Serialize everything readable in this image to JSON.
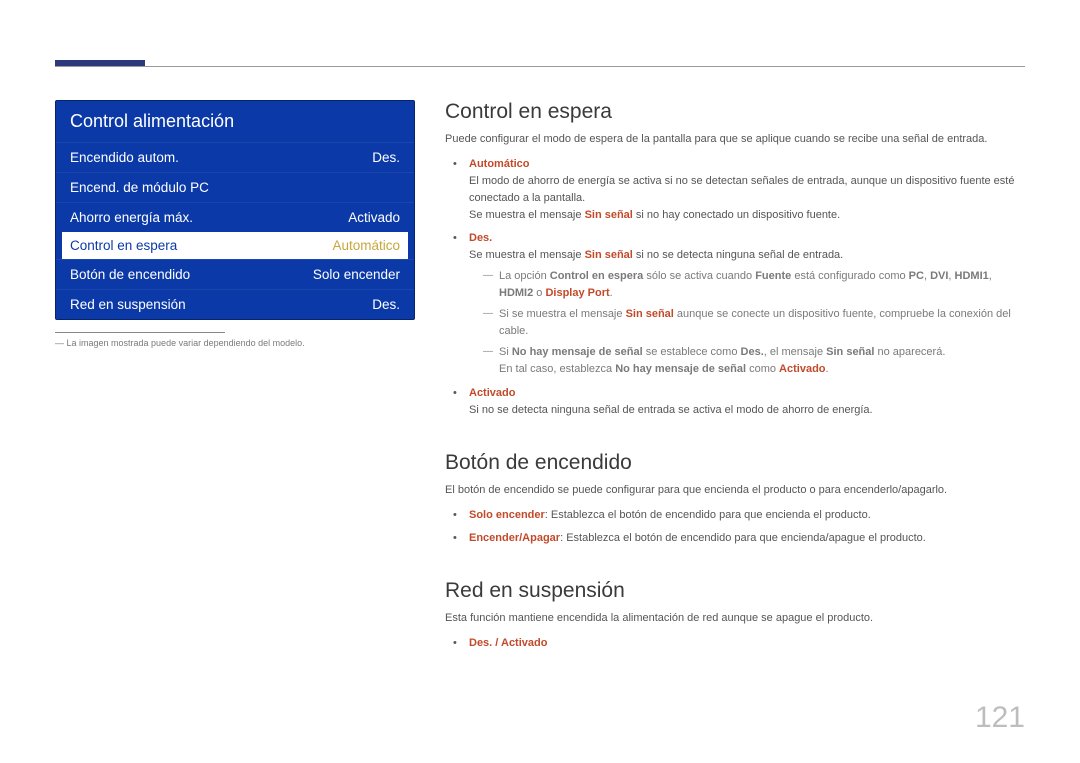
{
  "menu": {
    "title": "Control alimentación",
    "items": [
      {
        "label": "Encendido autom.",
        "value": "Des."
      },
      {
        "label": "Encend. de módulo PC",
        "value": ""
      },
      {
        "label": "Ahorro energía máx.",
        "value": "Activado"
      },
      {
        "label": "Control en espera",
        "value": "Automático",
        "selected": true
      },
      {
        "label": "Botón de encendido",
        "value": "Solo encender"
      },
      {
        "label": "Red en suspensión",
        "value": "Des."
      }
    ]
  },
  "footnote": "―  La imagen mostrada puede variar dependiendo del modelo.",
  "sections": {
    "control_en_espera": {
      "title": "Control en espera",
      "intro": "Puede configurar el modo de espera de la pantalla para que se aplique cuando se recibe una señal de entrada.",
      "items": {
        "auto_label": "Automático",
        "auto_line1": "El modo de ahorro de energía se activa si no se detectan señales de entrada, aunque un dispositivo fuente esté conectado a la pantalla.",
        "auto_line2_pre": "Se muestra el mensaje ",
        "auto_line2_b": "Sin señal",
        "auto_line2_post": " si no hay conectado un dispositivo fuente.",
        "des_label": "Des.",
        "des_line_pre": "Se muestra el mensaje ",
        "des_line_b": "Sin señal",
        "des_line_post": " si no se detecta ninguna señal de entrada.",
        "dash1_t1": "La opción ",
        "dash1_b1": "Control en espera",
        "dash1_t2": " sólo se activa cuando ",
        "dash1_b2": "Fuente",
        "dash1_t3": " está configurado como ",
        "dash1_b3": "PC",
        "dash1_comma1": ", ",
        "dash1_b4": "DVI",
        "dash1_comma2": ", ",
        "dash1_b5": "HDMI1",
        "dash1_comma3": ", ",
        "dash1_b6": "HDMI2",
        "dash1_t4": " o ",
        "dash1_b7": "Display Port",
        "dash1_dot": ".",
        "dash2_t1": "Si se muestra el mensaje ",
        "dash2_b1": "Sin señal",
        "dash2_t2": " aunque se conecte un dispositivo fuente, compruebe la conexión del cable.",
        "dash3_t1": "Si ",
        "dash3_b1": "No hay mensaje de señal",
        "dash3_t2": " se establece como ",
        "dash3_b2": "Des.",
        "dash3_t3": ", el mensaje ",
        "dash3_b3": "Sin señal",
        "dash3_t4": " no aparecerá.",
        "dash3_line2_t1": "En tal caso, establezca ",
        "dash3_line2_b1": "No hay mensaje de señal",
        "dash3_line2_t2": " como ",
        "dash3_line2_b2": "Activado",
        "dash3_line2_dot": ".",
        "activado_label": "Activado",
        "activado_line": "Si no se detecta ninguna señal de entrada se activa el modo de ahorro de energía."
      }
    },
    "boton": {
      "title": "Botón de encendido",
      "intro": "El botón de encendido se puede configurar para que encienda el producto o para encenderlo/apagarlo.",
      "it1_b": "Solo encender",
      "it1_t": ": Establezca el botón de encendido para que encienda el producto.",
      "it2_b": "Encender/Apagar",
      "it2_t": ": Establezca el botón de encendido para que encienda/apague el producto."
    },
    "red": {
      "title": "Red en suspensión",
      "intro": "Esta función mantiene encendida la alimentación de red aunque se apague el producto.",
      "opts": "Des. / Activado"
    }
  },
  "page_number": "121"
}
